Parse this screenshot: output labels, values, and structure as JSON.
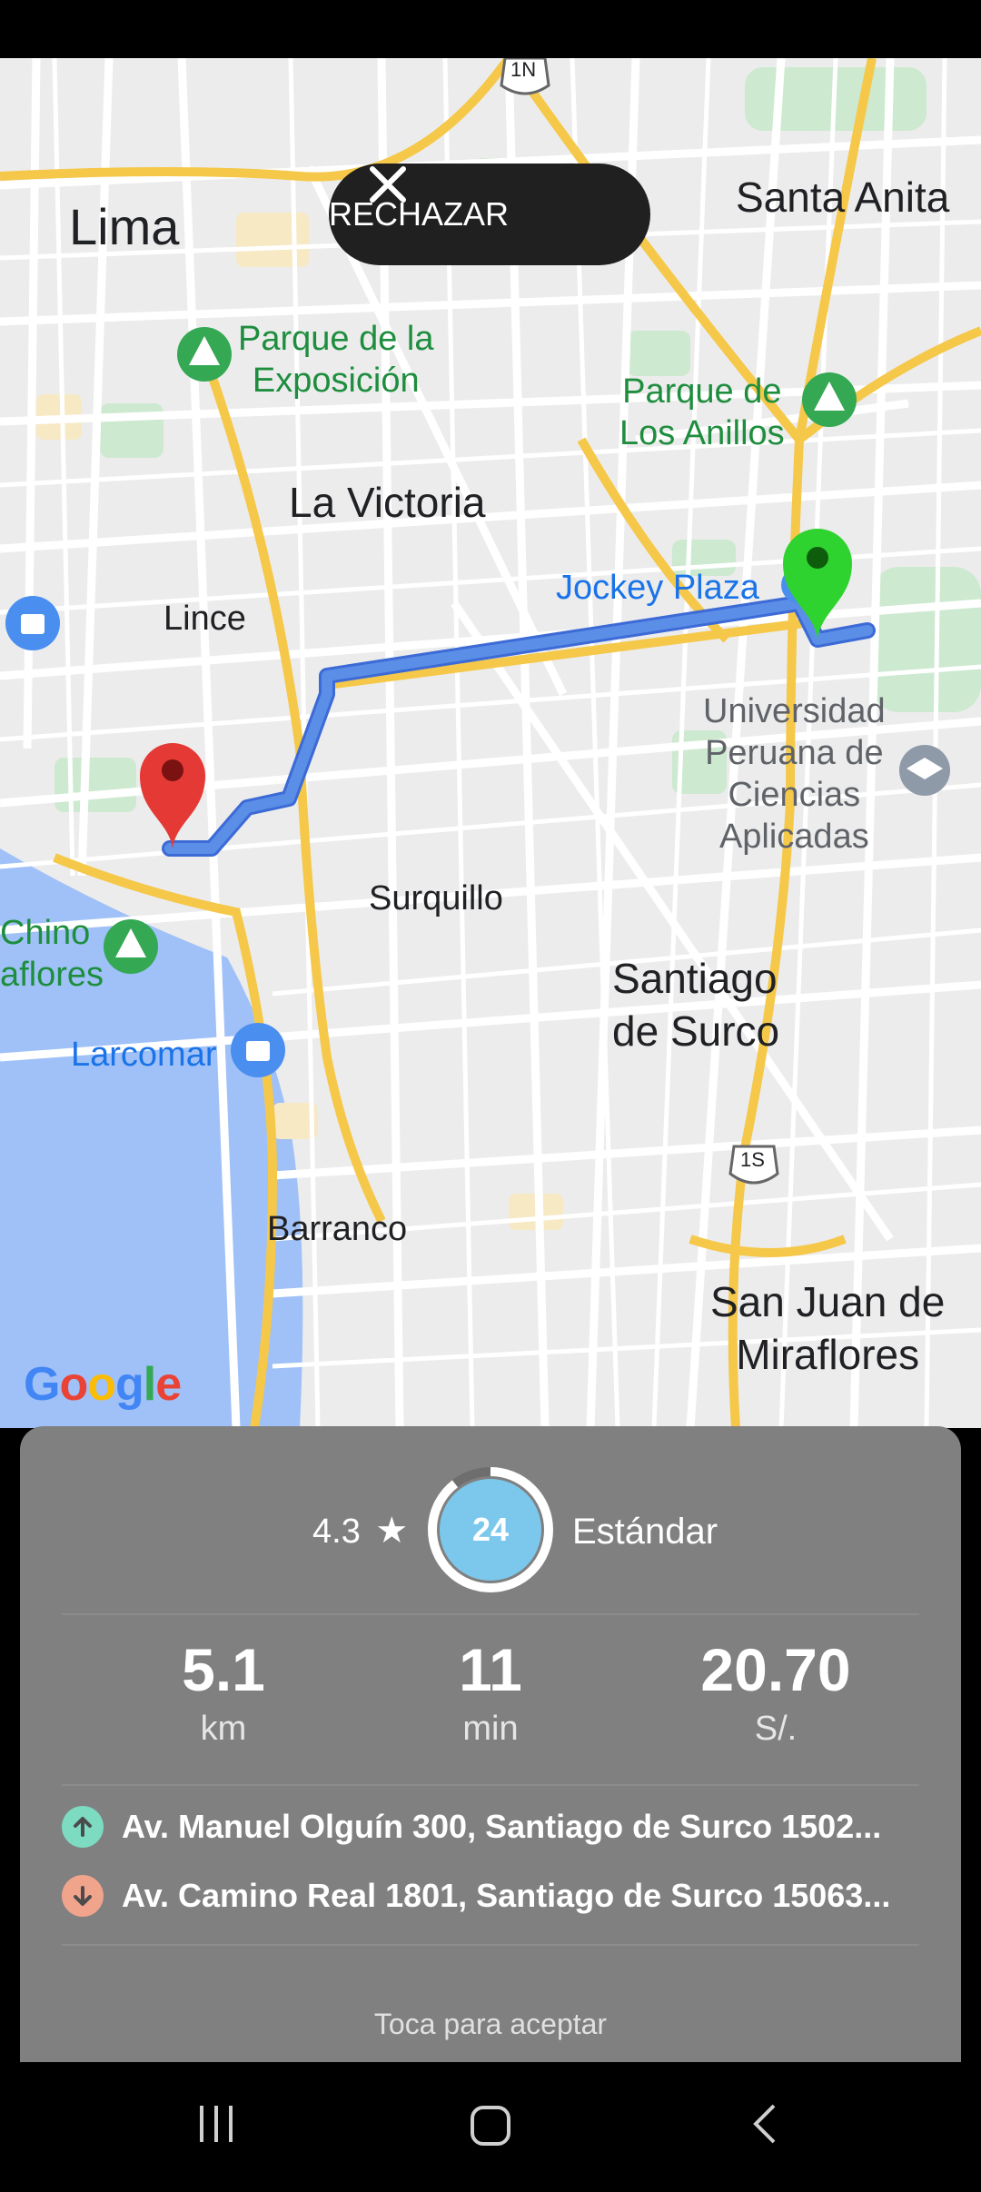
{
  "map": {
    "buttons": {
      "reject_label": "RECHAZAR"
    },
    "labels": {
      "lima": "Lima",
      "santa_anita": "Santa Anita",
      "parque_exposicion_1": "Parque de la",
      "parque_exposicion_2": "Exposición",
      "parque_anillos_1": "Parque de",
      "parque_anillos_2": "Los Anillos",
      "la_victoria": "La Victoria",
      "jockey_plaza": "Jockey Plaza",
      "lince": "Lince",
      "upc_1": "Universidad",
      "upc_2": "Peruana de",
      "upc_3": "Ciencias",
      "upc_4": "Aplicadas",
      "surquillo": "Surquillo",
      "chino_1": "Chino",
      "chino_2": "aflores",
      "santiago_1": "Santiago",
      "santiago_2": "de Surco",
      "larcomar": "Larcomar",
      "barranco": "Barranco",
      "sjm_1": "San Juan de",
      "sjm_2": "Miraflores",
      "route_1n": "1N",
      "route_1s": "1S",
      "google": "Google"
    }
  },
  "trip": {
    "rating": "4.3",
    "ring_value": "24",
    "category": "Estándar",
    "distance_value": "5.1",
    "distance_unit": "km",
    "time_value": "11",
    "time_unit": "min",
    "price_value": "20.70",
    "price_unit": "S/.",
    "pickup": "Av. Manuel Olguín 300, Santiago de Surco 1502...",
    "dropoff": "Av. Camino Real 1801, Santiago de Surco 15063...",
    "tap_label": "Toca para aceptar"
  },
  "colors": {
    "accent_ring": "#7cc8ec",
    "pickup_dot": "#7ddbc2",
    "dropoff_dot": "#f0a48b",
    "route": "#5b8ee6",
    "pin_green": "#2fd32f",
    "pin_red": "#e53935"
  },
  "icons": {
    "reject": "close-icon",
    "pickup": "arrow-up-icon",
    "dropoff": "arrow-down-icon",
    "star": "star-icon"
  }
}
